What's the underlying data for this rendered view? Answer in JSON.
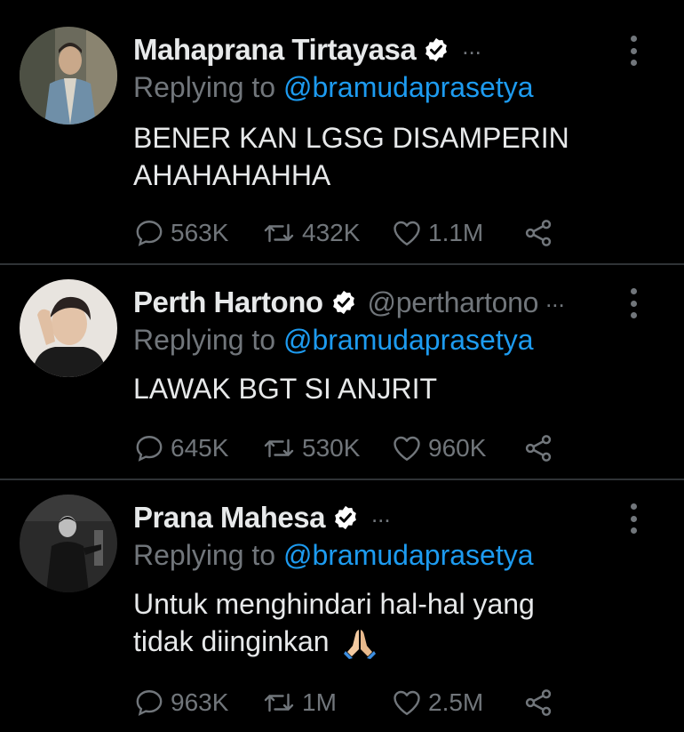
{
  "tweets": [
    {
      "name": "Mahaprana Tirtayasa",
      "handle": "",
      "handle_ellipsis": "...",
      "replying_prefix": "Replying to ",
      "replying_to": "@bramudaprasetya",
      "text_lines": [
        "BENER KAN LGSG DISAMPERIN",
        "AHAHAHAHHA"
      ],
      "replies": "563K",
      "retweets": "432K",
      "likes": "1.1M"
    },
    {
      "name": "Perth Hartono",
      "handle": "@perthartono",
      "handle_ellipsis": "...",
      "replying_prefix": "Replying to ",
      "replying_to": "@bramudaprasetya",
      "text_lines": [
        "LAWAK BGT SI ANJRIT"
      ],
      "replies": "645K",
      "retweets": "530K",
      "likes": "960K"
    },
    {
      "name": "Prana Mahesa",
      "handle": "",
      "handle_ellipsis": "...",
      "replying_prefix": "Replying to ",
      "replying_to": "@bramudaprasetya",
      "text_lines": [
        "Untuk menghindari hal-hal yang",
        "tidak diinginkan"
      ],
      "emoji": "folded-hands-emoji",
      "replies": "963K",
      "retweets": "1M",
      "likes": "2.5M"
    }
  ],
  "colors": {
    "background": "#000000",
    "text": "#e7e9ea",
    "secondary": "#71767b",
    "link": "#1d9bf0",
    "divider": "#2f3336"
  }
}
